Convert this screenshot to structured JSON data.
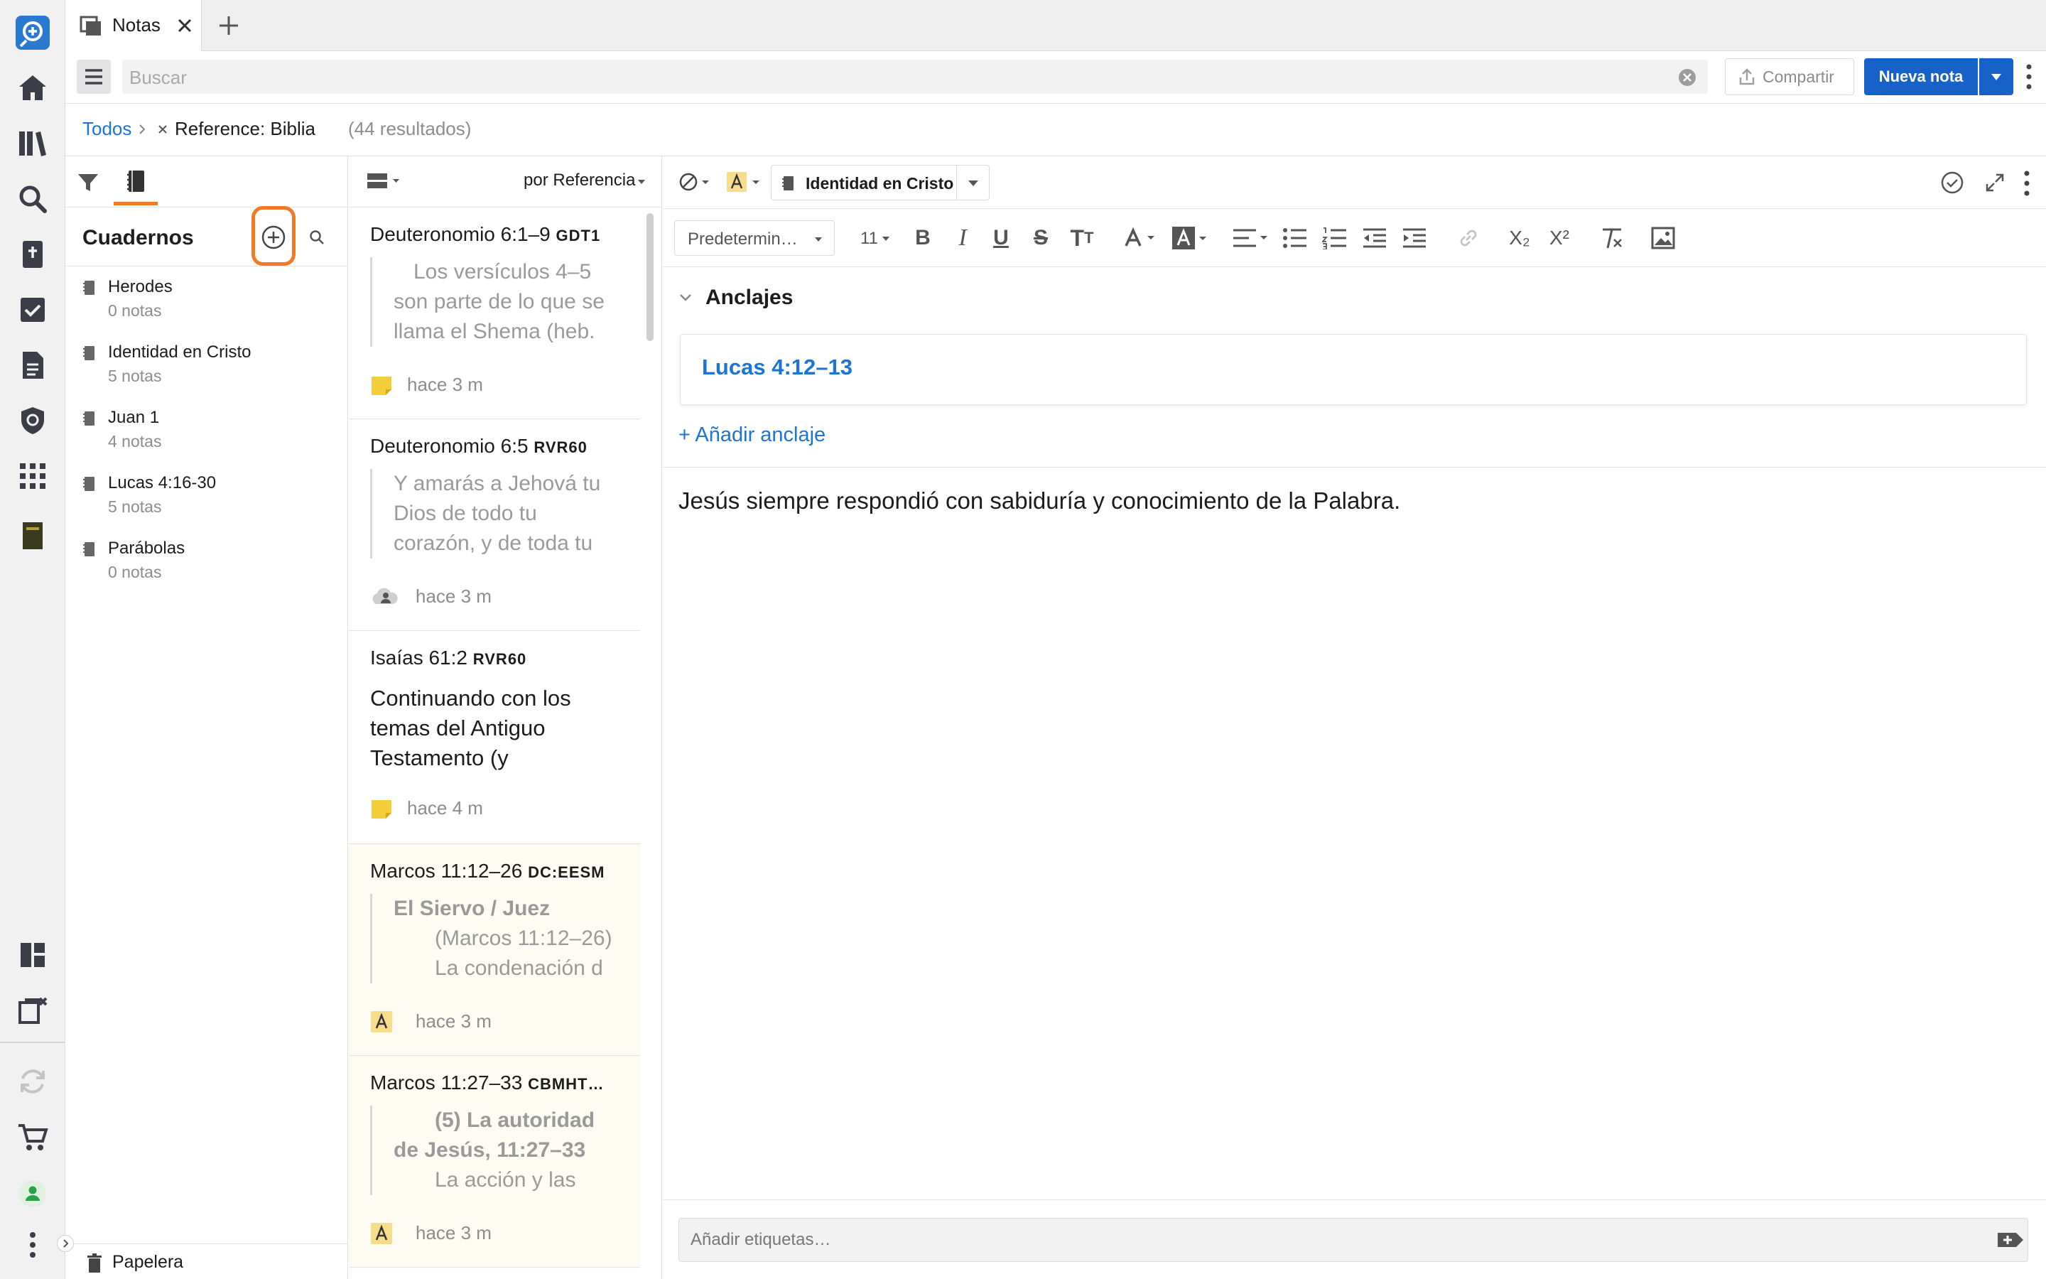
{
  "tab": {
    "title": "Notas"
  },
  "toolbar": {
    "search_placeholder": "Buscar",
    "share_label": "Compartir",
    "new_note_label": "Nueva nota"
  },
  "breadcrumb": {
    "root": "Todos",
    "filter": "Reference: Biblia",
    "count": "(44 resultados)"
  },
  "notebooks": {
    "title": "Cuadernos",
    "items": [
      {
        "name": "Herodes",
        "count": "0 notas"
      },
      {
        "name": "Identidad en Cristo",
        "count": "5 notas"
      },
      {
        "name": "Juan 1",
        "count": "4 notas"
      },
      {
        "name": "Lucas 4:16-30",
        "count": "5 notas"
      },
      {
        "name": "Parábolas",
        "count": "0 notas"
      }
    ],
    "trash_label": "Papelera"
  },
  "notes_list": {
    "sort_label": "por Referencia",
    "cards": [
      {
        "ref": "Deuteronomio 6:1–9",
        "version": "GDT1",
        "quote_lines": [
          "Los versículos 4–5",
          "son parte de lo que se",
          "llama el Shema (heb."
        ],
        "time": "hace 3 m",
        "icon": "sticky-note"
      },
      {
        "ref": "Deuteronomio 6:5",
        "version": "RVR60",
        "quote_lines": [
          "Y amarás a Jehová tu",
          "Dios de todo tu",
          "corazón, y de toda tu"
        ],
        "time": "hace 3 m",
        "icon": "cloud-user"
      },
      {
        "ref": "Isaías 61:2",
        "version": "RVR60",
        "body_lines": [
          "Continuando con los",
          "temas del Antiguo",
          "Testamento (y"
        ],
        "time": "hace 4 m",
        "icon": "sticky-note"
      },
      {
        "ref": "Marcos 11:12–26",
        "version": "DC:EESM",
        "quote_title_lines": [
          "El Siervo / Juez"
        ],
        "quote_lines": [
          "(Marcos 11:12–26)",
          "La condenación d"
        ],
        "time": "hace 3 m",
        "icon": "highlight-a"
      },
      {
        "ref": "Marcos 11:27–33",
        "version": "CBMHT…",
        "quote_title_lines": [
          "(5) La autoridad",
          "de Jesús, 11:27–33"
        ],
        "quote_lines": [
          "La acción y las"
        ],
        "time": "hace 3 m",
        "icon": "highlight-a"
      }
    ]
  },
  "editor": {
    "notebook_label": "Identidad en Cristo",
    "font_label": "Predetermin…",
    "size_label": "11",
    "anchors_title": "Anclajes",
    "anchor_link": "Lucas 4:12–13",
    "add_anchor": "+ Añadir anclaje",
    "content": "Jesús siempre respondió con sabiduría y conocimiento de la Palabra.",
    "tags_placeholder": "Añadir etiquetas…",
    "subscript_label": "X₂",
    "superscript_label": "X²"
  },
  "colors": {
    "accent": "#1762c9",
    "highlight": "#f07a26",
    "link": "#1b74d6"
  }
}
